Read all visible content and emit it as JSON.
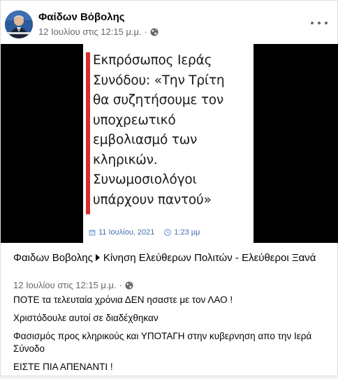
{
  "post": {
    "author": "Φαίδων Βόβολης",
    "timestamp": "12 Ιουλίου στις 12:15 μ.μ.",
    "separator": "·"
  },
  "media": {
    "headline_lines": [
      "Εκπρόσωπος Ιεράς",
      "Συνόδου: «Την Τρίτη",
      "θα συζητήσουμε τον",
      "υποχρεωτικό",
      "εμβολιασμό των",
      "κληρικών.",
      "Συνωμοσιολόγοι",
      "υπάρχουν παντού»"
    ],
    "date": "11 Ιουλίου, 2021",
    "time": "1:23 μμ"
  },
  "shared": {
    "author": "Φαιδων Βοβολης",
    "group": "Κίνηση Ελεύθερων Πολιτών - Ελεύθεροι Ξανά",
    "timestamp": "12 Ιουλίου στις 12:15 μ.μ.",
    "separator": "·",
    "paragraphs": [
      "ΠΟΤΕ τα τελευταία χρόνια ΔΕΝ ησαστε με τον ΛΑΟ !",
      "Χριστόδουλε αυτοί σε διαδέχθηκαν",
      "Φασισμός προς κληρικούς και ΥΠΟΤΑΓΗ στην κυβερνηση απο την Ιερά Σύνοδο",
      "ΕΙΣΤΕ ΠΙΑ ΑΠΕΝΑΝΤΙ !"
    ]
  },
  "colors": {
    "accent_red": "#d32f2f",
    "meta_gray": "#65676b",
    "date_blue": "#3f6fb0"
  },
  "icons": [
    "globe-icon",
    "more-options-icon",
    "calendar-icon",
    "clock-icon",
    "chevron-right-icon"
  ]
}
